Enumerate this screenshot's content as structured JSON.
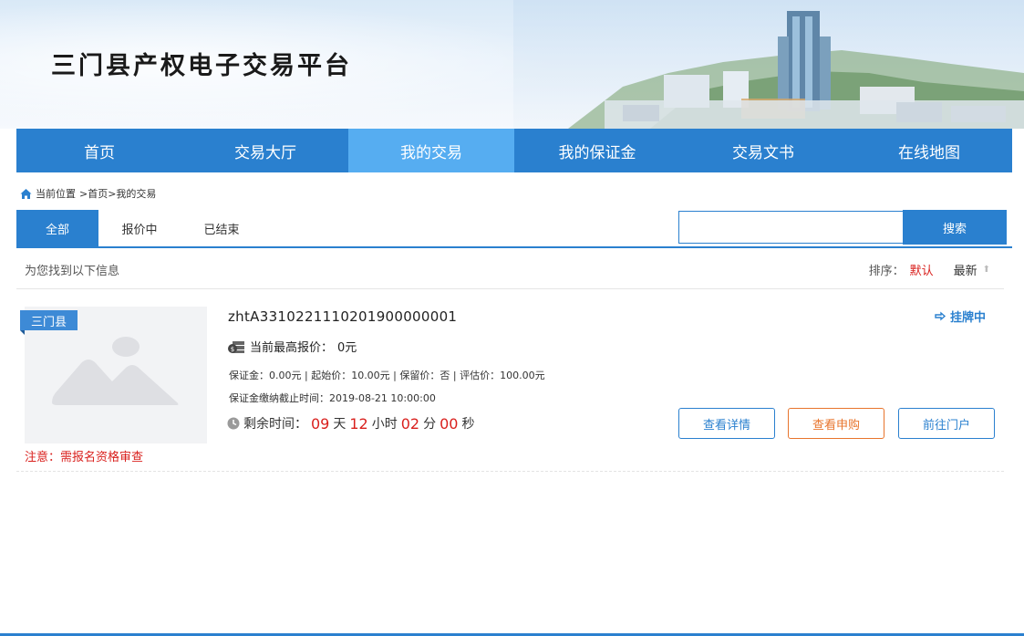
{
  "header": {
    "site_title": "三门县产权电子交易平台"
  },
  "nav": {
    "items": [
      "首页",
      "交易大厅",
      "我的交易",
      "我的保证金",
      "交易文书",
      "在线地图"
    ],
    "active_index": 2
  },
  "breadcrumb": {
    "label": "当前位置",
    "path": ">首页>我的交易"
  },
  "tabs": {
    "items": [
      "全部",
      "报价中",
      "已结束"
    ],
    "active_index": 0
  },
  "search": {
    "value": "",
    "placeholder": "",
    "button_label": "搜索"
  },
  "results": {
    "summary": "为您找到以下信息",
    "sort_label": "排序：",
    "sort_default": "默认",
    "sort_latest": "最新"
  },
  "listing": {
    "county_tag": "三门县",
    "notice_prefix": "注意：",
    "notice_text": "需报名资格审查",
    "code": "zhtA3310221110201900000001",
    "status": "挂牌中",
    "bid_label": "当前最高报价：",
    "bid_value": "0元",
    "deposit_line": "保证金：0.00元 | 起始价：10.00元 | 保留价：否 | 评估价：100.00元",
    "deadline_line": "保证金缴纳截止时间：2019-08-21 10:00:00",
    "countdown_label": "剩余时间：",
    "countdown": {
      "days": "09",
      "days_unit": "天",
      "hours": "12",
      "hours_unit": "小时",
      "minutes": "02",
      "minutes_unit": "分",
      "seconds": "00",
      "seconds_unit": "秒"
    },
    "buttons": {
      "detail": "查看详情",
      "apply": "查看申购",
      "portal": "前往门户"
    }
  },
  "colors": {
    "primary": "#2a80cf",
    "nav_active": "#56adf1",
    "accent_red": "#d9201d",
    "accent_orange": "#e8742c"
  }
}
